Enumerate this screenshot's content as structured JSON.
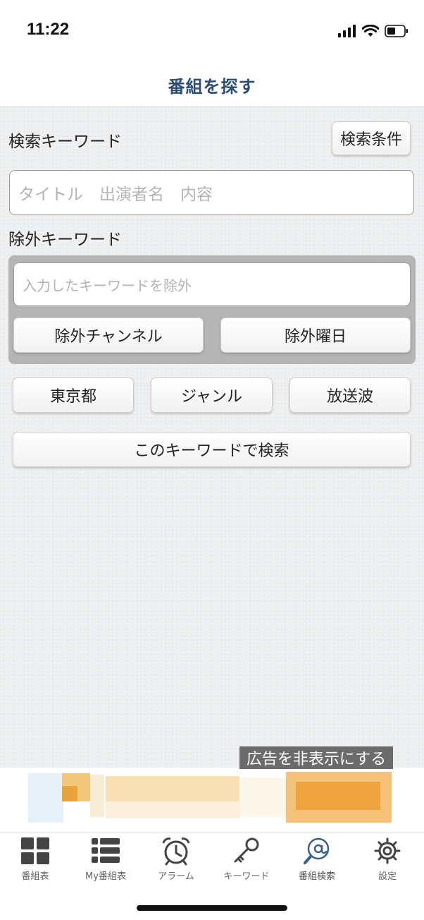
{
  "status": {
    "time": "11:22"
  },
  "nav": {
    "title": "番組を探す"
  },
  "search": {
    "keyword_label": "検索キーワード",
    "conditions_button": "検索条件",
    "keyword_placeholder": "タイトル　出演者名　内容",
    "exclude_label": "除外キーワード",
    "exclude_placeholder": "入力したキーワードを除外",
    "exclude_channel_button": "除外チャンネル",
    "exclude_day_button": "除外曜日",
    "region_button": "東京都",
    "genre_button": "ジャンル",
    "broadcast_button": "放送波",
    "search_button": "このキーワードで検索"
  },
  "ad": {
    "hide_label": "広告を非表示にする"
  },
  "tabs": [
    {
      "label": "番組表",
      "icon": "grid-icon"
    },
    {
      "label": "My番組表",
      "icon": "list-icon"
    },
    {
      "label": "アラーム",
      "icon": "alarm-clock-icon"
    },
    {
      "label": "キーワード",
      "icon": "key-icon"
    },
    {
      "label": "番組検索",
      "icon": "at-search-icon"
    },
    {
      "label": "設定",
      "icon": "gear-icon"
    }
  ],
  "colors": {
    "title": "#2b4d74",
    "active_tab": "#3a5f8a",
    "tab_icon": "#444444"
  }
}
